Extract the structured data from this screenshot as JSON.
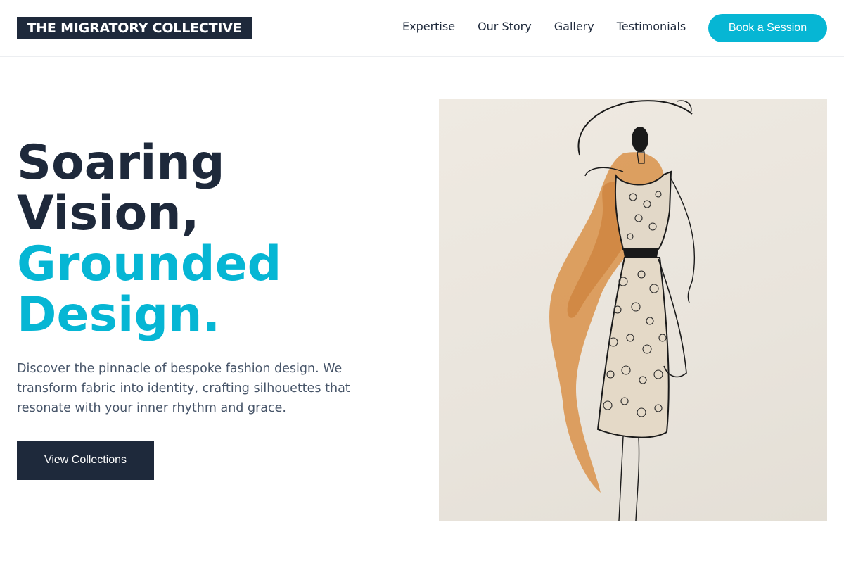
{
  "brand": {
    "name": "THE MIGRATORY COLLECTIVE"
  },
  "nav": {
    "items": [
      {
        "label": "Expertise"
      },
      {
        "label": "Our Story"
      },
      {
        "label": "Gallery"
      },
      {
        "label": "Testimonials"
      }
    ],
    "cta_label": "Book a Session"
  },
  "hero": {
    "headline_line1": "Soaring",
    "headline_line2": "Vision,",
    "headline_line3": "Grounded",
    "headline_line4": "Design.",
    "description": "Discover the pinnacle of bespoke fashion design. We transform fabric into identity, crafting silhouettes that resonate with your inner rhythm and grace.",
    "button_label": "View Collections",
    "image_subject": "fashion-sketch-illustration"
  },
  "colors": {
    "primary_dark": "#1e293b",
    "accent": "#06b6d4",
    "body_text": "#475569",
    "sketch_wash": "#d9924a"
  }
}
